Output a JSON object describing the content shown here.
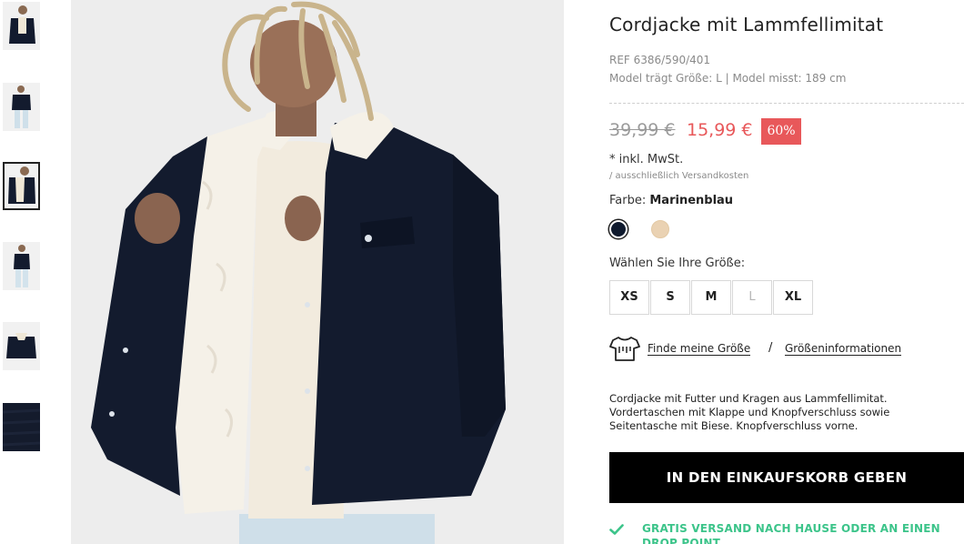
{
  "product": {
    "title": "Cordjacke mit Lammfellimitat",
    "ref": "REF 6386/590/401",
    "model_info": "Model trägt Größe: L | Model misst: 189 cm",
    "old_price": "39,99 €",
    "new_price": "15,99 €",
    "discount": "60%",
    "vat": "* inkl. MwSt.",
    "shipping_note": "/ ausschließlich Versandkosten",
    "color_label": "Farbe:",
    "color_name": "Marinenblau",
    "colors": [
      "#0f1a2e",
      "#ead2b3"
    ],
    "size_label": "Wählen Sie Ihre Größe:",
    "sizes": [
      {
        "label": "XS",
        "available": true
      },
      {
        "label": "S",
        "available": true
      },
      {
        "label": "M",
        "available": true
      },
      {
        "label": "L",
        "available": false
      },
      {
        "label": "XL",
        "available": true
      }
    ],
    "find_size_link": "Finde meine Größe",
    "separator": "/",
    "size_info_link": "Größeninformationen",
    "description": "Cordjacke mit Futter und Kragen aus Lammfellimitat. Vordertaschen mit Klappe und Knopfverschluss sowie Seitentasche mit Biese. Knopfverschluss vorne.",
    "add_to_cart": "IN DEN EINKAUFSKORB GEBEN",
    "free_shipping": "GRATIS VERSAND NACH HAUSE ODER AN EINEN DROP POINT"
  },
  "gallery": {
    "thumbnail_count": 6,
    "selected_index": 2
  },
  "colors_theme": {
    "sale_red": "#e8585a",
    "success_green": "#3cc48a",
    "jacket_navy": "#131b2e",
    "button_black": "#000000"
  },
  "icons": [
    "tshirt-icon",
    "check-icon"
  ]
}
